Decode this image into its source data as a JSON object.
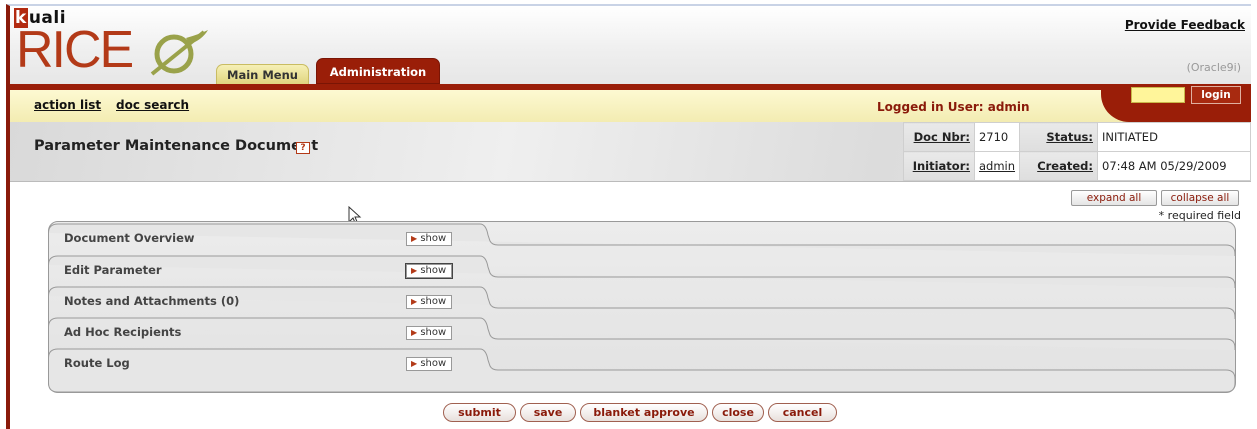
{
  "brand": {
    "kuali": "uali",
    "kuali_k": "k",
    "rice": "RICE"
  },
  "tabs": {
    "main_menu": "Main Menu",
    "administration": "Administration"
  },
  "header": {
    "feedback": "Provide Feedback",
    "db": "(Oracle9i)"
  },
  "nav": {
    "action_list": "action list",
    "doc_search": "doc search",
    "logged_in": "Logged in User: admin",
    "login_label": "login"
  },
  "doc": {
    "title": "Parameter Maintenance Document",
    "help": "?",
    "doc_nbr_label": "Doc Nbr:",
    "doc_nbr": "2710",
    "status_label": "Status:",
    "status": "INITIATED",
    "initiator_label": "Initiator:",
    "initiator": "admin",
    "created_label": "Created:",
    "created": "07:48 AM 05/29/2009"
  },
  "controls": {
    "expand_all": "expand all",
    "collapse_all": "collapse all",
    "required": "* required field"
  },
  "sections": [
    {
      "label": "Document Overview",
      "show": "show"
    },
    {
      "label": "Edit Parameter",
      "show": "show"
    },
    {
      "label": "Notes and Attachments (0)",
      "show": "show"
    },
    {
      "label": "Ad Hoc Recipients",
      "show": "show"
    },
    {
      "label": "Route Log",
      "show": "show"
    }
  ],
  "actions": {
    "submit": "submit",
    "save": "save",
    "blanket_approve": "blanket approve",
    "close": "close",
    "cancel": "cancel"
  },
  "colors": {
    "brand_red": "#9a1e08",
    "tab_yellow": "#f6f0b6",
    "nav_yellow": "#fdf9d2"
  }
}
